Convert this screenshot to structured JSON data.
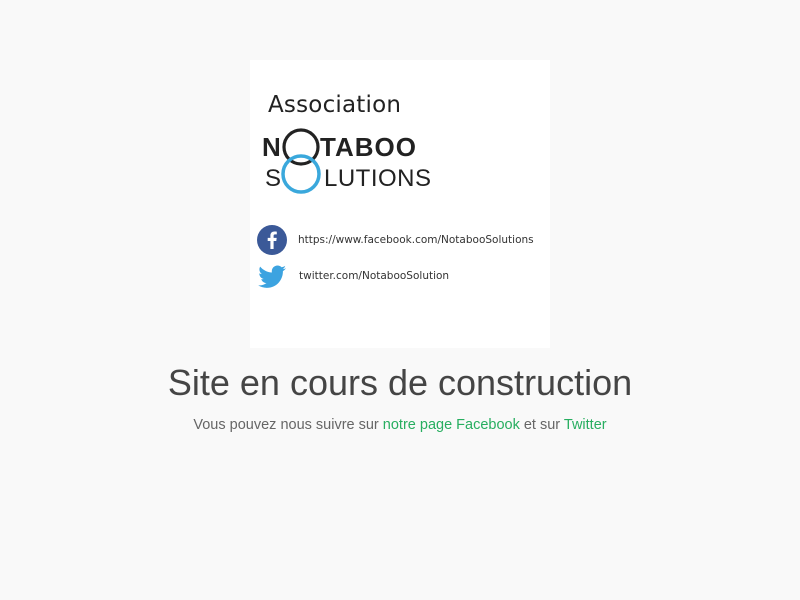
{
  "logo": {
    "association": "Association",
    "brand_line1": "NOTABOO",
    "brand_line2": "SOLUTIONS",
    "facebook_url": "https://www.facebook.com/NotabooSolutions",
    "twitter_url": "twitter.com/NotabooSolution",
    "colors": {
      "brand_dark": "#222222",
      "brand_blue": "#3aa8dc",
      "facebook": "#3b5998",
      "twitter": "#3ca3e0"
    }
  },
  "main": {
    "headline": "Site en cours de construction",
    "sub_prefix": "Vous pouvez nous suivre sur ",
    "facebook_link": "notre page Facebook",
    "sub_middle": " et sur ",
    "twitter_link": "Twitter"
  },
  "colors": {
    "background": "#f9f9f9",
    "link": "#27ae60",
    "headline": "#454545"
  }
}
